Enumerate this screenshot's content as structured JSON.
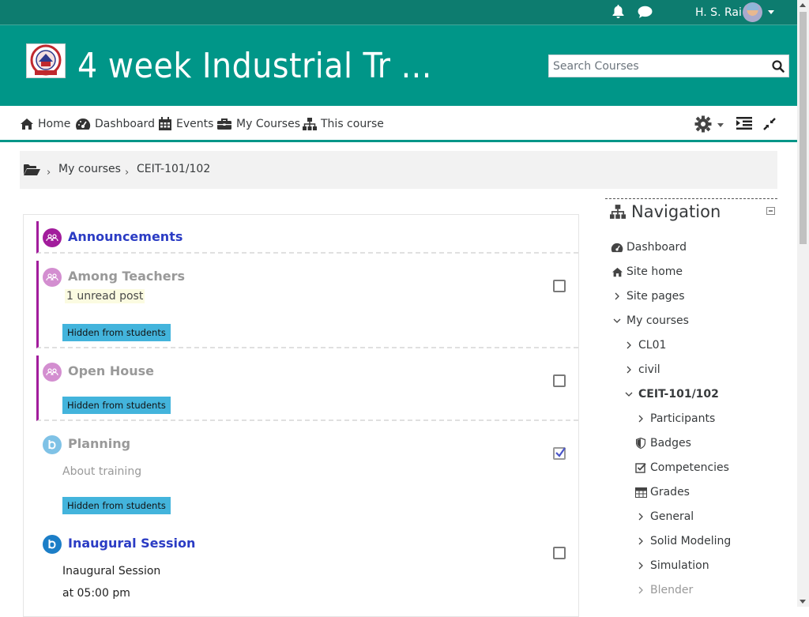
{
  "topbar": {
    "username": "H. S. Rai",
    "bell_icon": "bell-icon",
    "message_icon": "chat-icon"
  },
  "header": {
    "course_title": "4 week Industrial Tr ...",
    "search_placeholder": "Search Courses",
    "logo_icon": "university-logo"
  },
  "navbar": {
    "items": [
      {
        "label": "Home",
        "icon": "home-icon"
      },
      {
        "label": "Dashboard",
        "icon": "dashboard-icon"
      },
      {
        "label": "Events",
        "icon": "calendar-icon"
      },
      {
        "label": "My Courses",
        "icon": "briefcase-icon"
      },
      {
        "label": "This course",
        "icon": "sitemap-icon"
      }
    ]
  },
  "breadcrumb": {
    "items": [
      "My courses",
      "CEIT-101/102"
    ]
  },
  "activities": [
    {
      "title": "Announcements",
      "type": "forum"
    },
    {
      "title": "Among Teachers",
      "type": "forum",
      "unread": "1 unread post",
      "badge": "Hidden from students",
      "checked": false
    },
    {
      "title": "Open House",
      "type": "forum",
      "badge": "Hidden from students",
      "checked": false
    },
    {
      "title": "Planning",
      "type": "bigbluebutton",
      "description": "About training",
      "badge": "Hidden from students",
      "checked": true
    },
    {
      "title": "Inaugural Session",
      "type": "bigbluebutton",
      "description": "Inaugural Session",
      "time": "at 05:00 pm",
      "checked": false
    }
  ],
  "navigation": {
    "title": "Navigation",
    "items": [
      {
        "label": "Dashboard",
        "icon": "dashboard-icon"
      },
      {
        "label": "Site home",
        "icon": "home-icon"
      },
      {
        "label": "Site pages",
        "icon": "chevron-right-icon"
      },
      {
        "label": "My courses",
        "icon": "chevron-down-icon"
      },
      {
        "label": "CL01",
        "icon": "chevron-right-icon"
      },
      {
        "label": "civil",
        "icon": "chevron-right-icon"
      },
      {
        "label": "CEIT-101/102",
        "icon": "chevron-down-icon"
      },
      {
        "label": "Participants",
        "icon": "chevron-right-icon"
      },
      {
        "label": "Badges",
        "icon": "shield-icon"
      },
      {
        "label": "Competencies",
        "icon": "check-square-icon"
      },
      {
        "label": "Grades",
        "icon": "table-icon"
      },
      {
        "label": "General",
        "icon": "chevron-right-icon"
      },
      {
        "label": "Solid Modeling",
        "icon": "chevron-right-icon"
      },
      {
        "label": "Simulation",
        "icon": "chevron-right-icon"
      },
      {
        "label": "Blender",
        "icon": "chevron-right-icon"
      }
    ]
  },
  "colors": {
    "header": "#009688",
    "topbar": "#0d7c6f",
    "link": "#2b3cc4",
    "forum_border": "#a21c9c",
    "badge": "#43b4dc"
  }
}
